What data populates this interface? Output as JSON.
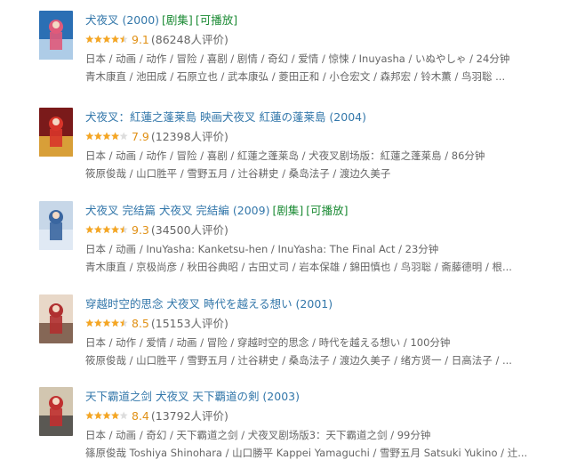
{
  "colors": {
    "link": "#3377aa",
    "tag": "#1a8a33",
    "score": "#e09015",
    "star_full": "#f5a623",
    "star_empty": "#dddddd",
    "meta": "#666666"
  },
  "movies": [
    {
      "title": "犬夜叉 (2000)",
      "tags": [
        "[剧集]",
        "[可播放]"
      ],
      "stars": 4.5,
      "score": "9.1",
      "votes": "(86248人评价)",
      "meta": "日本 / 动画 / 动作 / 冒险 / 喜剧 / 剧情 / 奇幻 / 爱情 / 惊悚 / Inuyasha / いぬやしゃ / 24分钟",
      "cast": "青木康直 / 池田成 / 石原立也 / 武本康弘 / 菱田正和 / 小仓宏文 / 森邦宏 / 铃木薫 / 鸟羽聡 ..."
    },
    {
      "title": "犬夜叉：紅蓮之蓬莱島 映画犬夜叉 紅蓮の蓬莱島 (2004)",
      "tags": [],
      "stars": 4,
      "score": "7.9",
      "votes": "(12398人评价)",
      "meta": "日本 / 动画 / 动作 / 冒险 / 喜剧 / 紅蓮之蓬莱岛 / 犬夜叉剧场版：紅蓮之蓬莱島 / 86分钟",
      "cast": "筱原俊哉 / 山口胜平 / 雪野五月 / 辻谷耕史 / 桑岛法子 / 渡边久美子"
    },
    {
      "title": "犬夜叉 完结篇 犬夜叉 完結編 (2009)",
      "tags": [
        "[剧集]",
        "[可播放]"
      ],
      "stars": 4.5,
      "score": "9.3",
      "votes": "(34500人评价)",
      "meta": "日本 / 动画 / InuYasha: Kanketsu-hen / InuYasha: The Final Act / 23分钟",
      "cast": "青木康直 / 京极尚彦 / 秋田谷典昭 / 古田丈司 / 岩本保雄 / 錦田慎也 / 鸟羽聡 / 斋藤德明 / 根..."
    },
    {
      "title": "穿越时空的思念 犬夜叉 時代を越える想い (2001)",
      "tags": [],
      "stars": 4.5,
      "score": "8.5",
      "votes": "(15153人评价)",
      "meta": "日本 / 动作 / 爱情 / 动画 / 冒险 / 穿越时空的思念 / 時代を越える想い / 100分钟",
      "cast": "筱原俊哉 / 山口胜平 / 雪野五月 / 辻谷耕史 / 桑岛法子 / 渡边久美子 / 绪方贤一 / 日高法子 / ..."
    },
    {
      "title": "天下霸道之剑 犬夜叉 天下覇道の剣 (2003)",
      "tags": [],
      "stars": 4,
      "score": "8.4",
      "votes": "(13792人评价)",
      "meta": "日本 / 动画 / 奇幻 / 天下霸道之剑 / 犬夜叉剧场版3：天下霸道之剑 / 99分钟",
      "cast": "篠原俊哉 Toshiya Shinohara / 山口勝平 Kappei Yamaguchi / 雪野五月 Satsuki Yukino / 辻..."
    }
  ]
}
